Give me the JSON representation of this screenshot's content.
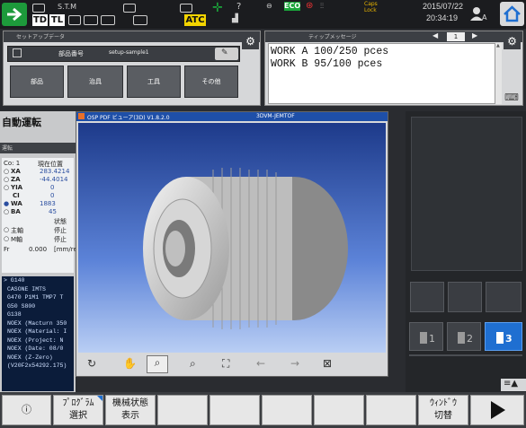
{
  "status": {
    "smt_label": "S.T.M",
    "td_label": "TD",
    "tl_label": "TL",
    "atc_label": "ATC",
    "eco_label": "ECO",
    "caps_label": "Caps",
    "lock_label": "Lock",
    "date": "2015/07/22",
    "time": "20:34:19",
    "user_label": "A"
  },
  "setup": {
    "header": "セットアップデータ",
    "field_label": "部品番号",
    "field_value": "setup-sample1",
    "buttons": [
      "部品",
      "治具",
      "工具",
      "その他"
    ]
  },
  "tip": {
    "header": "ティップメッセージ",
    "page": "1",
    "lines": [
      "WORK A 100/250 pces",
      "WORK B 95/100 pces"
    ]
  },
  "auto_op": {
    "title": "自動運転",
    "subtitle": "運転",
    "coord_header_left": "Co:  1",
    "coord_header_right": "現在位置",
    "axes": [
      {
        "name": "XA",
        "value": "283.4214"
      },
      {
        "name": "ZA",
        "value": "-44.4014"
      },
      {
        "name": "YIA",
        "value": "0"
      },
      {
        "name": "CI",
        "value": "0"
      },
      {
        "name": "WA",
        "value": "1883"
      },
      {
        "name": "BA",
        "value": "45"
      }
    ],
    "state_header": "状態",
    "spindles": [
      {
        "name": "主軸",
        "state": "停止"
      },
      {
        "name": "M軸",
        "state": "停止"
      }
    ],
    "feed_label": "Fr",
    "feed_value": "0.000",
    "feed_unit": "[mm/re",
    "program_lines": [
      "> G140",
      "CASONE IMTS",
      "G470 P1M1 TMP7 T",
      "G50  S800",
      "G138",
      "NOEX (Macturn 350",
      "NOEX (Material: I",
      "NOEX (Project: N",
      "NOEX (Date: 08/0",
      "NOEX (Z-Zero)",
      "(V20F2x54292.175)"
    ]
  },
  "viewer": {
    "title": "OSP PDF ビューア(3D) V1.8.2.0",
    "file": "3DVM-JEMTOF",
    "tools": [
      "rotate-icon",
      "pan-icon",
      "zoom-icon",
      "zoom-window-icon",
      "fit-icon",
      "back-icon",
      "forward-icon",
      "close-view-icon"
    ]
  },
  "right_panel": {
    "page_buttons": [
      "1",
      "2",
      "3"
    ],
    "active_page": "3"
  },
  "function_keys": [
    {
      "line1": "",
      "line2": ""
    },
    {
      "line1": "ﾌﾟﾛｸﾞﾗﾑ",
      "line2": "選択"
    },
    {
      "line1": "機械状態",
      "line2": "表示"
    },
    {
      "line1": "",
      "line2": ""
    },
    {
      "line1": "",
      "line2": ""
    },
    {
      "line1": "",
      "line2": ""
    },
    {
      "line1": "ｳｨﾝﾄﾞｳ",
      "line2": "切替"
    }
  ],
  "colors": {
    "eco_green": "#1aa53a",
    "atc_yellow": "#f3d400",
    "active_blue": "#1f6fd1",
    "status_bar": "#1b1c1f"
  }
}
